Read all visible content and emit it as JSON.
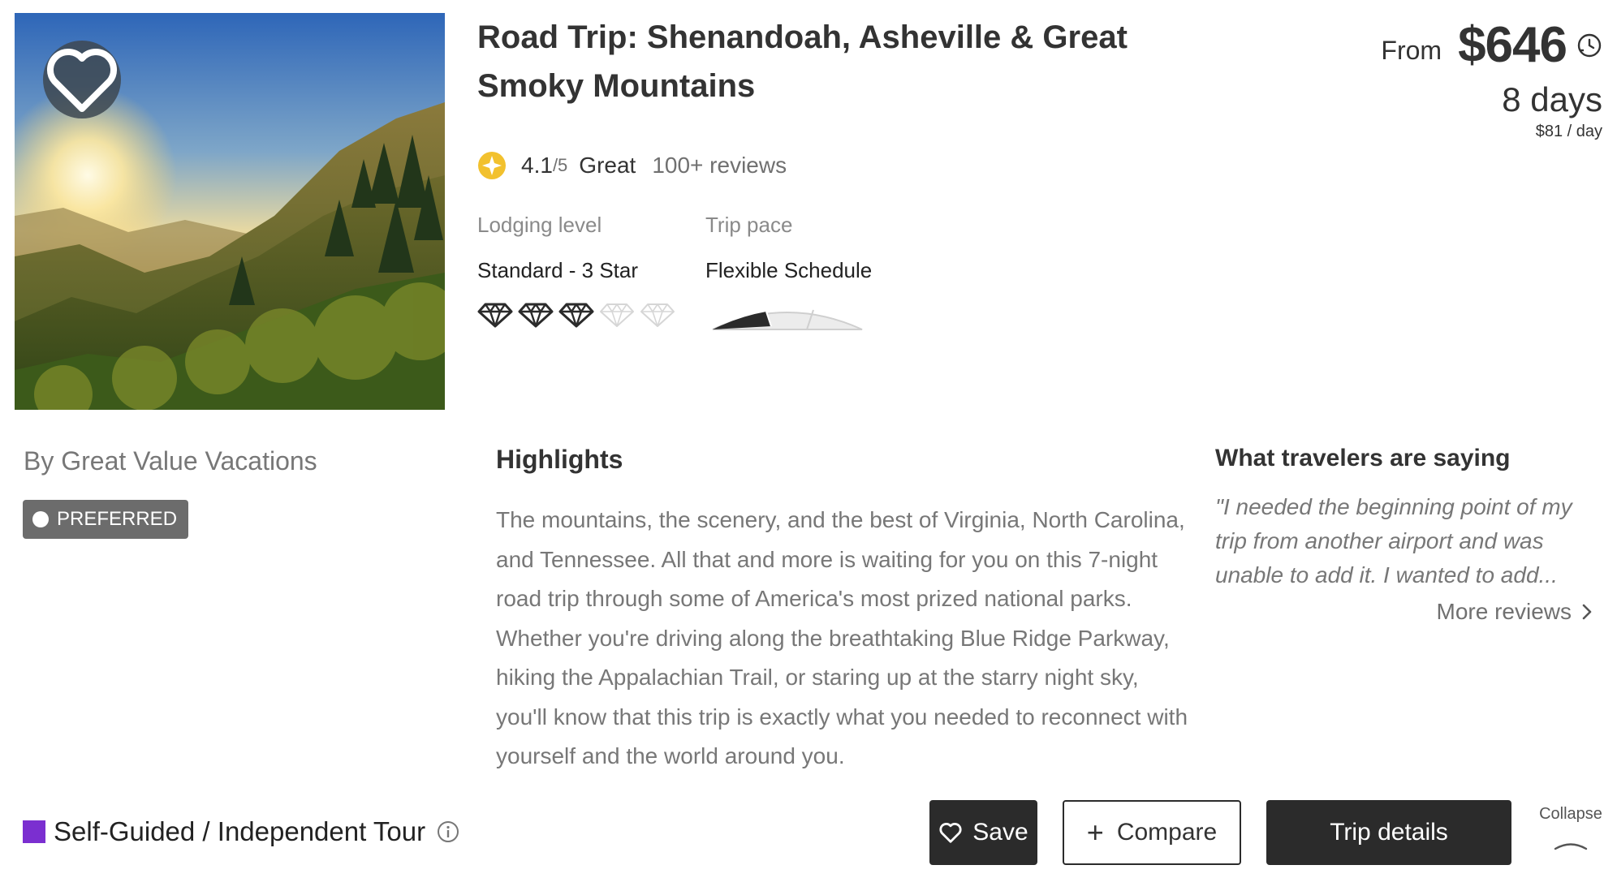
{
  "listing": {
    "title": "Road Trip: Shenandoah, Asheville & Great Smoky Mountains",
    "rating": {
      "score": "4.1",
      "max": "/5",
      "word": "Great",
      "reviews": "100+ reviews"
    },
    "lodging": {
      "label": "Lodging level",
      "value": "Standard - 3 Star",
      "diamonds_filled": 3,
      "diamonds_total": 5
    },
    "pace": {
      "label": "Trip pace",
      "value": "Flexible Schedule",
      "level": "1 of 4"
    }
  },
  "price": {
    "from": "From",
    "amount": "$646",
    "days": "8 days",
    "per_day": "$81 / day"
  },
  "operator": {
    "by": "By Great Value Vacations",
    "badge": "PREFERRED"
  },
  "highlights": {
    "title": "Highlights",
    "body": "The mountains, the scenery, and the best of Virginia, North Carolina, and Tennessee. All that and more is waiting for you on this 7-night road trip through some of America's most prized national parks. Whether you're driving along the breathtaking Blue Ridge Parkway, hiking the Appalachian Trail, or staring up at the starry night sky, you'll know that this trip is exactly what you needed to reconnect with yourself and the world around you."
  },
  "reviews": {
    "title": "What travelers are saying",
    "quote": "\"I needed the beginning point of my trip from another airport and was unable to add it. I wanted to add...",
    "more": "More reviews"
  },
  "footer": {
    "tour_type": "Self-Guided / Independent Tour",
    "tour_color": "#7b2fd0",
    "save": "Save",
    "compare": "Compare",
    "trip_details": "Trip details",
    "collapse": "Collapse"
  },
  "icons": [
    "heart-icon",
    "rating-badge-icon",
    "diamond-icon",
    "pace-meter-icon",
    "clock-icon",
    "chevron-right-icon",
    "info-icon",
    "plus-icon",
    "chevron-up-icon"
  ]
}
